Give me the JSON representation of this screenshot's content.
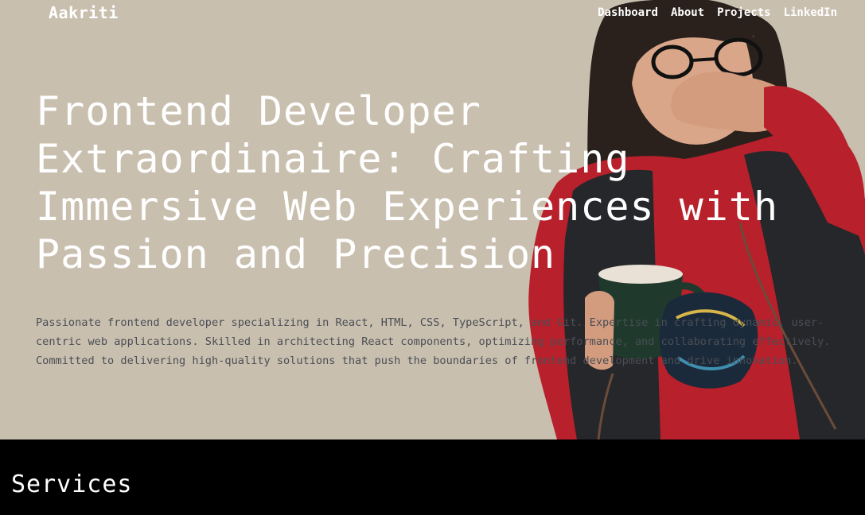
{
  "brand": {
    "name": "Aakriti"
  },
  "nav": {
    "links": [
      "Dashboard",
      "About",
      "Projects",
      "LinkedIn"
    ]
  },
  "hero": {
    "headline": "Frontend Developer Extraordinaire: Crafting Immersive Web Experiences with Passion and Precision",
    "intro": "Passionate frontend developer specializing in React, HTML, CSS, TypeScript, and Git. Expertise in crafting dynamic, user-centric web applications. Skilled in architecting React components, optimizing performance, and collaborating effectively. Committed to delivering high-quality solutions that push the boundaries of frontend development and drive innovation."
  },
  "services": {
    "title": "Services"
  },
  "colors": {
    "hero_background": "#c9bfaf",
    "headline_text": "#ffffff",
    "intro_text": "#4a4e55",
    "services_background": "#000000"
  }
}
